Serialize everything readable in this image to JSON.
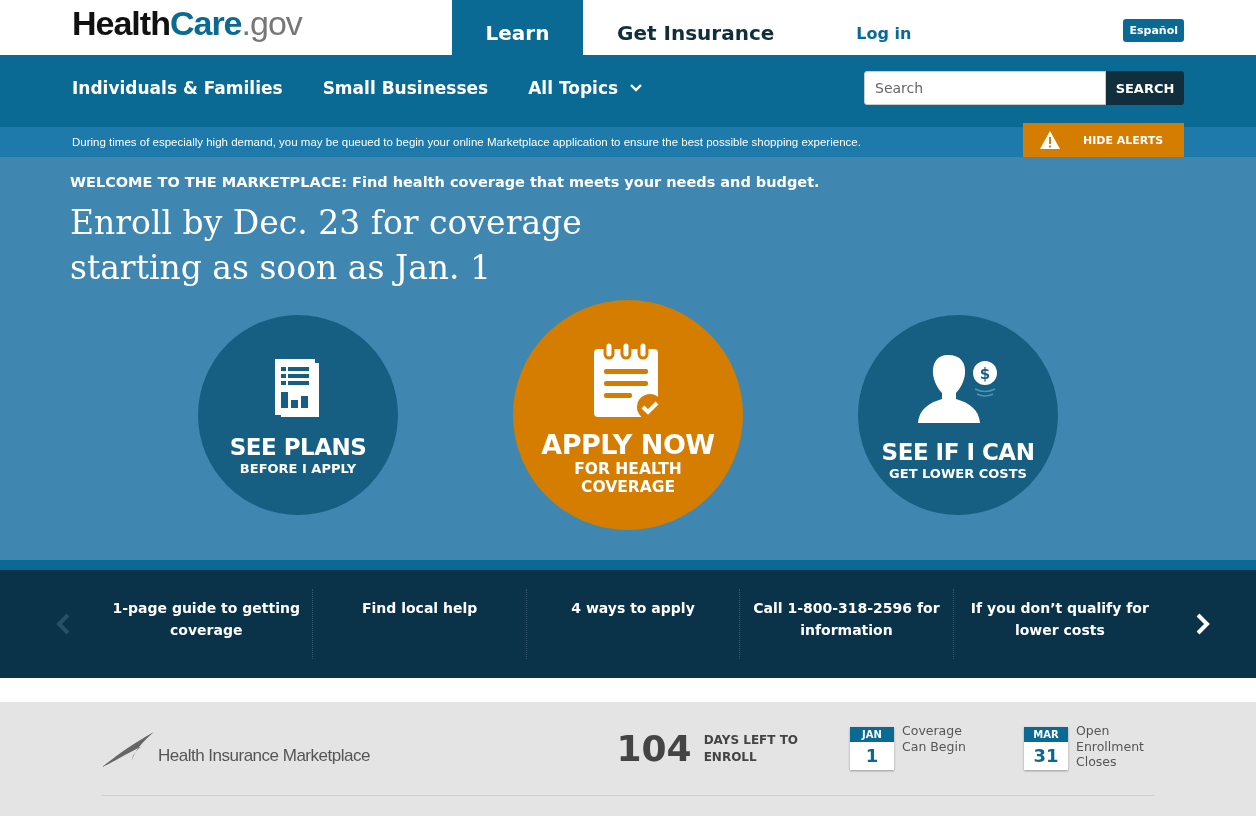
{
  "logo": [
    "Health",
    "Care",
    ".gov"
  ],
  "top_tabs": [
    {
      "label": "Learn",
      "selected": true
    },
    {
      "label": "Get Insurance",
      "selected": false
    }
  ],
  "login": "Log in",
  "language": "Español",
  "nav": [
    {
      "label": "Individuals & Families",
      "has_menu": false
    },
    {
      "label": "Small Businesses",
      "has_menu": false
    },
    {
      "label": "All Topics",
      "has_menu": true
    }
  ],
  "search": {
    "placeholder": "Search",
    "button": "SEARCH"
  },
  "alert": {
    "text": "During times of especially high demand, you may be queued to begin your online Marketplace application to ensure the best possible shopping experience.",
    "button": "HIDE ALERTS"
  },
  "hero": {
    "eyebrow": "WELCOME TO THE MARKETPLACE: Find health coverage that meets your needs and budget.",
    "headline": [
      "Enroll by Dec. 23 for coverage",
      "starting as soon as Jan. 1"
    ],
    "actions": [
      {
        "kind": "plans",
        "title": "SEE PLANS",
        "subtitle": "BEFORE I APPLY"
      },
      {
        "kind": "apply",
        "title": "APPLY NOW",
        "subtitle": "FOR HEALTH COVERAGE"
      },
      {
        "kind": "savings",
        "title": "SEE IF I CAN",
        "subtitle": "GET LOWER COSTS",
        "badge": "$"
      }
    ]
  },
  "quick_links": {
    "prev_disabled": true,
    "items": [
      "1-page guide to getting coverage",
      "Find local help",
      "4 ways to apply",
      "Call 1-800-318-2596 for information",
      "If you don’t qualify for lower costs"
    ]
  },
  "footer": {
    "brand": "Health Insurance Marketplace",
    "days": "104",
    "days_label": "DAYS LEFT TO ENROLL",
    "dates": [
      {
        "month": "JAN",
        "day": "1",
        "label": "Coverage Can Begin"
      },
      {
        "month": "MAR",
        "day": "31",
        "label": "Open Enrollment Closes"
      }
    ]
  }
}
